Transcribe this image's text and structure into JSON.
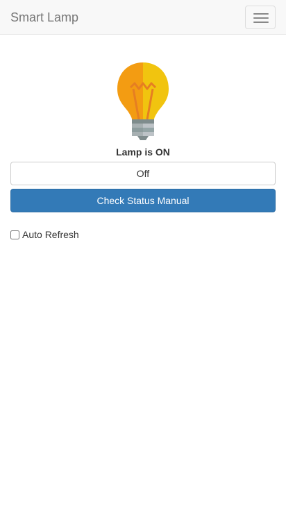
{
  "header": {
    "brand": "Smart Lamp",
    "menu_icon": "hamburger-menu-icon"
  },
  "lamp": {
    "icon": "light-bulb-icon",
    "state": "on",
    "status_text": "Lamp is ON",
    "colors": {
      "glass_left": "#f39c12",
      "glass_right": "#f1c40f",
      "base": "#95a5a6"
    }
  },
  "controls": {
    "toggle_label": "Off",
    "check_label": "Check Status Manual",
    "check_color": "#337ab7"
  },
  "auto_refresh": {
    "label": "Auto Refresh",
    "checked": false
  }
}
